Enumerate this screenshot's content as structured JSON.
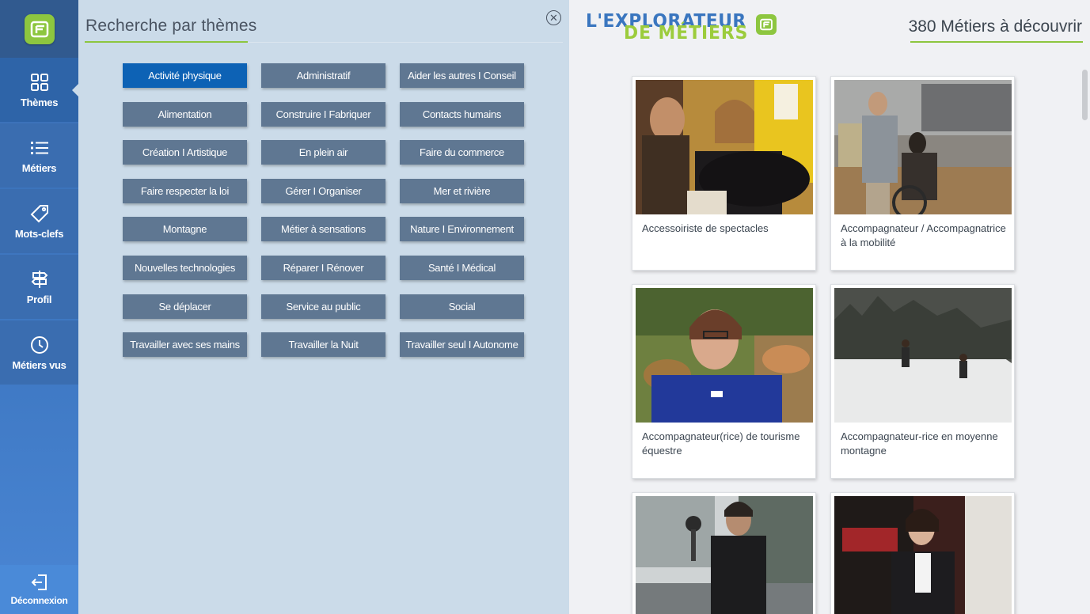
{
  "sidebar": {
    "items": [
      {
        "label": "Thèmes",
        "icon": "grid-icon"
      },
      {
        "label": "Métiers",
        "icon": "list-icon"
      },
      {
        "label": "Mots-clefs",
        "icon": "tag-icon"
      },
      {
        "label": "Profil",
        "icon": "signpost-icon"
      },
      {
        "label": "Métiers vus",
        "icon": "clock-icon"
      }
    ],
    "logout_label": "Déconnexion"
  },
  "themes_panel": {
    "title": "Recherche par thèmes",
    "close_icon": "close-icon",
    "themes": [
      {
        "label": "Activité physique",
        "active": true
      },
      {
        "label": "Administratif"
      },
      {
        "label": "Aider les autres I Conseil"
      },
      {
        "label": "Alimentation"
      },
      {
        "label": "Construire I Fabriquer"
      },
      {
        "label": "Contacts humains"
      },
      {
        "label": "Création I Artistique"
      },
      {
        "label": "En plein air"
      },
      {
        "label": "Faire du commerce"
      },
      {
        "label": "Faire respecter la loi"
      },
      {
        "label": "Gérer I Organiser"
      },
      {
        "label": "Mer et rivière"
      },
      {
        "label": "Montagne"
      },
      {
        "label": "Métier à sensations"
      },
      {
        "label": "Nature I Environnement"
      },
      {
        "label": "Nouvelles technologies"
      },
      {
        "label": "Réparer I Rénover"
      },
      {
        "label": "Santé I Médical"
      },
      {
        "label": "Se déplacer"
      },
      {
        "label": "Service au public"
      },
      {
        "label": "Social"
      },
      {
        "label": "Travailler avec ses mains"
      },
      {
        "label": "Travailler la Nuit"
      },
      {
        "label": "Travailler seul I Autonome"
      }
    ]
  },
  "header": {
    "brand_line1": "L'EXPLORATEUR",
    "brand_line2": "DE MÉTIERS",
    "brand_registered": "®",
    "count_text": "380 Métiers à découvrir"
  },
  "jobs": [
    {
      "title": "Accessoiriste de spectacles"
    },
    {
      "title": "Accompagnateur / Accompagnatrice à la mobilité"
    },
    {
      "title": "Accompagnateur(rice) de tourisme équestre"
    },
    {
      "title": "Accompagnateur-rice en moyenne montagne"
    },
    {
      "title": ""
    },
    {
      "title": ""
    }
  ],
  "colors": {
    "sidebar": "#3a6fb4",
    "panel_bg": "#cbdbe9",
    "theme_button": "#5f7792",
    "theme_button_active": "#0d62b5",
    "accent_green": "#8dc63f"
  }
}
